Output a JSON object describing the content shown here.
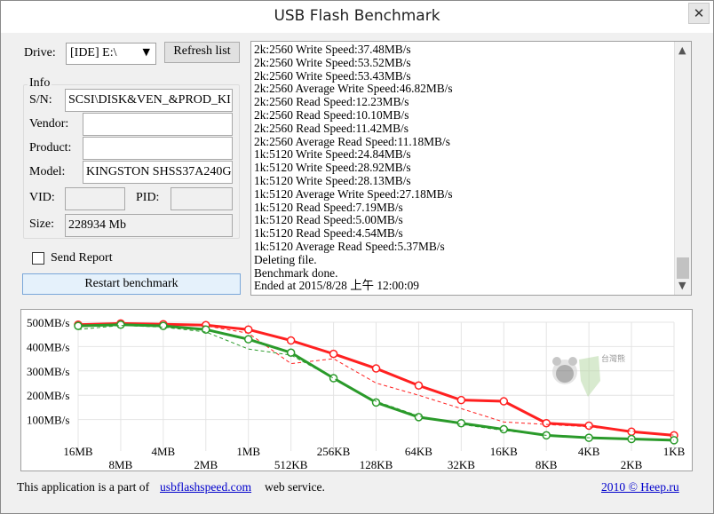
{
  "window": {
    "title": "USB Flash Benchmark",
    "close_glyph": "✕"
  },
  "drive": {
    "label": "Drive:",
    "selected": "[IDE] E:\\",
    "refresh_label": "Refresh list"
  },
  "info": {
    "legend": "Info",
    "sn_label": "S/N:",
    "sn_value": "SCSI\\DISK&VEN_&PROD_KI",
    "vendor_label": "Vendor:",
    "vendor_value": "",
    "product_label": "Product:",
    "product_value": "",
    "model_label": "Model:",
    "model_value": "KINGSTON SHSS37A240G",
    "vid_label": "VID:",
    "vid_value": "",
    "pid_label": "PID:",
    "pid_value": "",
    "size_label": "Size:",
    "size_value": "228934 Mb"
  },
  "send_report_label": "Send Report",
  "restart_label": "Restart benchmark",
  "log_lines": [
    "2k:2560 Write Speed:37.48MB/s",
    "2k:2560 Write Speed:53.52MB/s",
    "2k:2560 Write Speed:53.43MB/s",
    "2k:2560 Average Write Speed:46.82MB/s",
    "2k:2560 Read Speed:12.23MB/s",
    "2k:2560 Read Speed:10.10MB/s",
    "2k:2560 Read Speed:11.42MB/s",
    "2k:2560 Average Read Speed:11.18MB/s",
    "1k:5120 Write Speed:24.84MB/s",
    "1k:5120 Write Speed:28.92MB/s",
    "1k:5120 Write Speed:28.13MB/s",
    "1k:5120 Average Write Speed:27.18MB/s",
    "1k:5120 Read Speed:7.19MB/s",
    "1k:5120 Read Speed:5.00MB/s",
    "1k:5120 Read Speed:4.54MB/s",
    "1k:5120 Average Read Speed:5.37MB/s",
    "Deleting file.",
    "Benchmark done.",
    "Ended at 2015/8/28 上午 12:00:09"
  ],
  "footer": {
    "prefix": "This application is a part of",
    "link": "usbflashspeed.com",
    "suffix": "web service.",
    "copyright": "2010 © Heep.ru"
  },
  "watermark_text": "台灣熊",
  "chart_data": {
    "type": "line",
    "categories": [
      "16MB",
      "8MB",
      "4MB",
      "2MB",
      "1MB",
      "512KB",
      "256KB",
      "128KB",
      "64KB",
      "32KB",
      "16KB",
      "8KB",
      "4KB",
      "2KB",
      "1KB"
    ],
    "ylim": [
      0,
      500
    ],
    "yticks": [
      100,
      200,
      300,
      400,
      500
    ],
    "ytick_labels": [
      "100MB/s",
      "200MB/s",
      "300MB/s",
      "400MB/s",
      "500MB/s"
    ],
    "colors": {
      "read": "#ff2020",
      "write": "#2a9a2a"
    },
    "series": [
      {
        "id": "read",
        "style": "avg",
        "values": [
          490,
          495,
          492,
          488,
          470,
          425,
          370,
          310,
          240,
          180,
          175,
          85,
          75,
          50,
          35
        ]
      },
      {
        "id": "read_run",
        "style": "run",
        "values": [
          480,
          493,
          490,
          485,
          455,
          330,
          350,
          250,
          200,
          145,
          90,
          80,
          70,
          52,
          36
        ]
      },
      {
        "id": "write",
        "style": "avg",
        "values": [
          485,
          490,
          485,
          470,
          430,
          375,
          270,
          170,
          110,
          85,
          60,
          35,
          25,
          20,
          15
        ]
      },
      {
        "id": "write_run",
        "style": "run",
        "values": [
          470,
          487,
          480,
          460,
          390,
          365,
          270,
          175,
          115,
          80,
          55,
          35,
          25,
          20,
          15
        ]
      }
    ]
  }
}
